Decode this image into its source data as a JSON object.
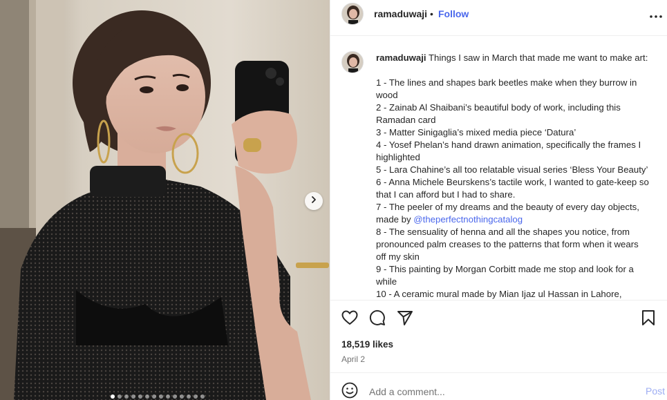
{
  "header": {
    "username": "ramaduwaji",
    "separator": "•",
    "follow_label": "Follow"
  },
  "caption": {
    "username": "ramaduwaji",
    "intro": "Things I saw in March that made me want to make art:",
    "lines": [
      "1 - The lines and shapes bark beetles make when they burrow in",
      "wood",
      "2 - Zainab Al Shaibani’s beautiful body of work, including this",
      "Ramadan card",
      "3 - Matter Sinigaglia’s mixed media piece ‘Datura’",
      "4 - Yosef Phelan’s hand drawn animation, specifically the frames I",
      "highlighted",
      "5 - Lara Chahine’s all too relatable visual series ‘Bless Your Beauty’",
      "6 - Anna Michele Beurskens’s tactile work, I wanted to gate-keep so",
      "that I can afford but I had to share.",
      "7 - The peeler of my dreams and the beauty of every day objects,",
      "made by",
      "8 - The sensuality of henna and all the shapes you notice, from",
      "pronounced palm creases to the patterns that form when it wears",
      "off my skin",
      "9 - This painting by Morgan Corbitt made me stop and look for a",
      "while",
      "10 - A ceramic mural made by Mian Ijaz ul Hassan in Lahore,"
    ],
    "mention": "@theperfectnothingcatalog"
  },
  "engagement": {
    "likes": "18,519 likes",
    "date": "April 2"
  },
  "comment": {
    "placeholder": "Add a comment...",
    "post_label": "Post"
  },
  "carousel": {
    "total_slides": 14,
    "active_index": 0
  },
  "icons": [
    "heart-icon",
    "comment-icon",
    "share-icon",
    "bookmark-icon",
    "more-icon",
    "emoji-icon",
    "chevron-right-icon"
  ],
  "colors": {
    "link": "#4a67ec",
    "post_disabled": "#9dadf3",
    "text": "#262626",
    "muted": "#737373",
    "divider": "#efefef"
  }
}
